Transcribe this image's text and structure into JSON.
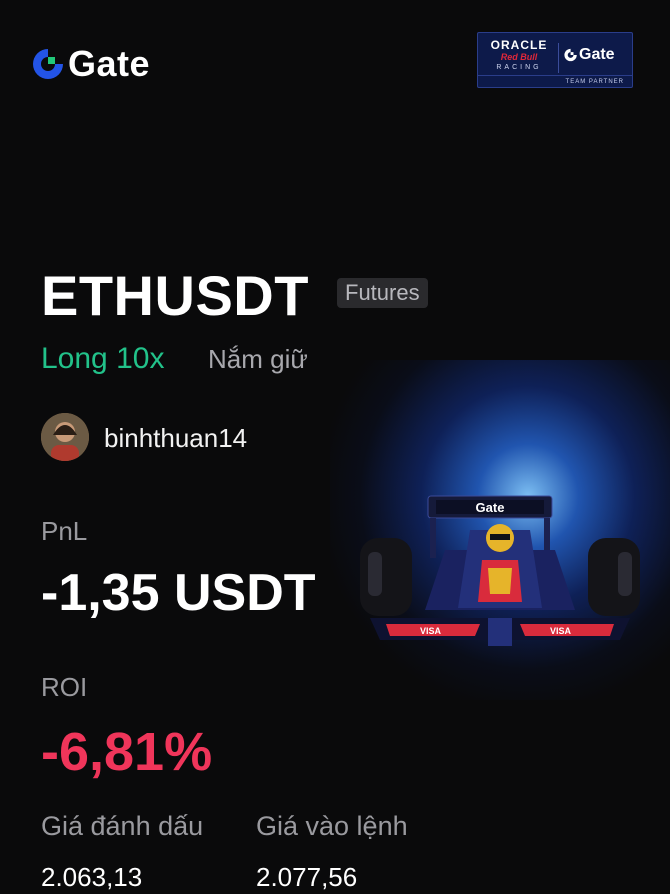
{
  "header": {
    "logo_text": "Gate",
    "logo_icon": "gate-logo-icon",
    "partner": {
      "oracle": "ORACLE",
      "redbull": "Red Bull",
      "racing": "RACING",
      "gate": "Gate",
      "team_partner": "TEAM PARTNER"
    }
  },
  "position": {
    "pair": "ETHUSDT",
    "market_badge": "Futures",
    "side": "Long 10x",
    "status": "Nắm giữ"
  },
  "user": {
    "username": "binhthuan14",
    "avatar_icon": "user-avatar"
  },
  "stats": {
    "pnl_label": "PnL",
    "pnl_value": "-1,35 USDT",
    "roi_label": "ROI",
    "roi_value": "-6,81%",
    "mark_price_label": "Giá đánh dấu",
    "mark_price_value": "2.063,13",
    "entry_price_label": "Giá vào lệnh",
    "entry_price_value": "2.077,56"
  },
  "colors": {
    "background": "#0a0a0b",
    "long_green": "#22c28a",
    "loss_red": "#f0355a",
    "brand_blue": "#2354e6"
  }
}
